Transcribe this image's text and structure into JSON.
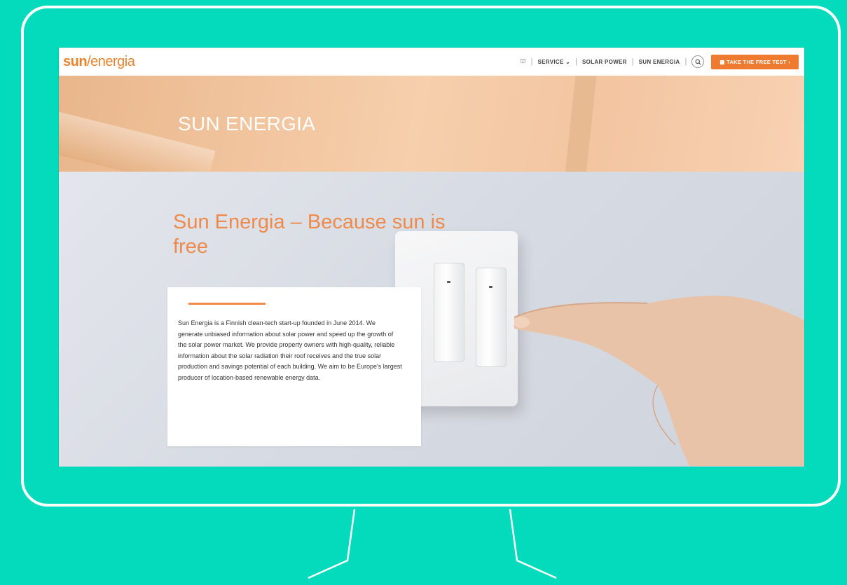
{
  "site": {
    "logo": {
      "part1": "sun",
      "part2": "/",
      "part3": "energia"
    },
    "nav": {
      "home_icon": "home-icon",
      "service": "SERVICE",
      "service_chevron": "⌄",
      "solar_power": "SOLAR POWER",
      "sun_energia": "SUN ENERGIA",
      "search_icon": "search-icon",
      "cta": "▦ TAKE THE FREE TEST ›"
    },
    "banner": {
      "title": "SUN ENERGIA"
    },
    "hero": {
      "title": "Sun Energia – Because sun is free",
      "body": "Sun Energia is a Finnish clean-tech start-up founded in June 2014. We generate unbiased information about solar power and speed up the growth of the solar power market. We provide property owners with high-quality, reliable information about the solar radiation their roof receives and the true solar production and savings potential of each building. We aim to be Europe's largest producer of location-based renewable energy data."
    }
  },
  "colors": {
    "background": "#04dbbd",
    "accent": "#ee7b30",
    "hero_title": "#ef8a4a",
    "frame": "#ffffff"
  }
}
